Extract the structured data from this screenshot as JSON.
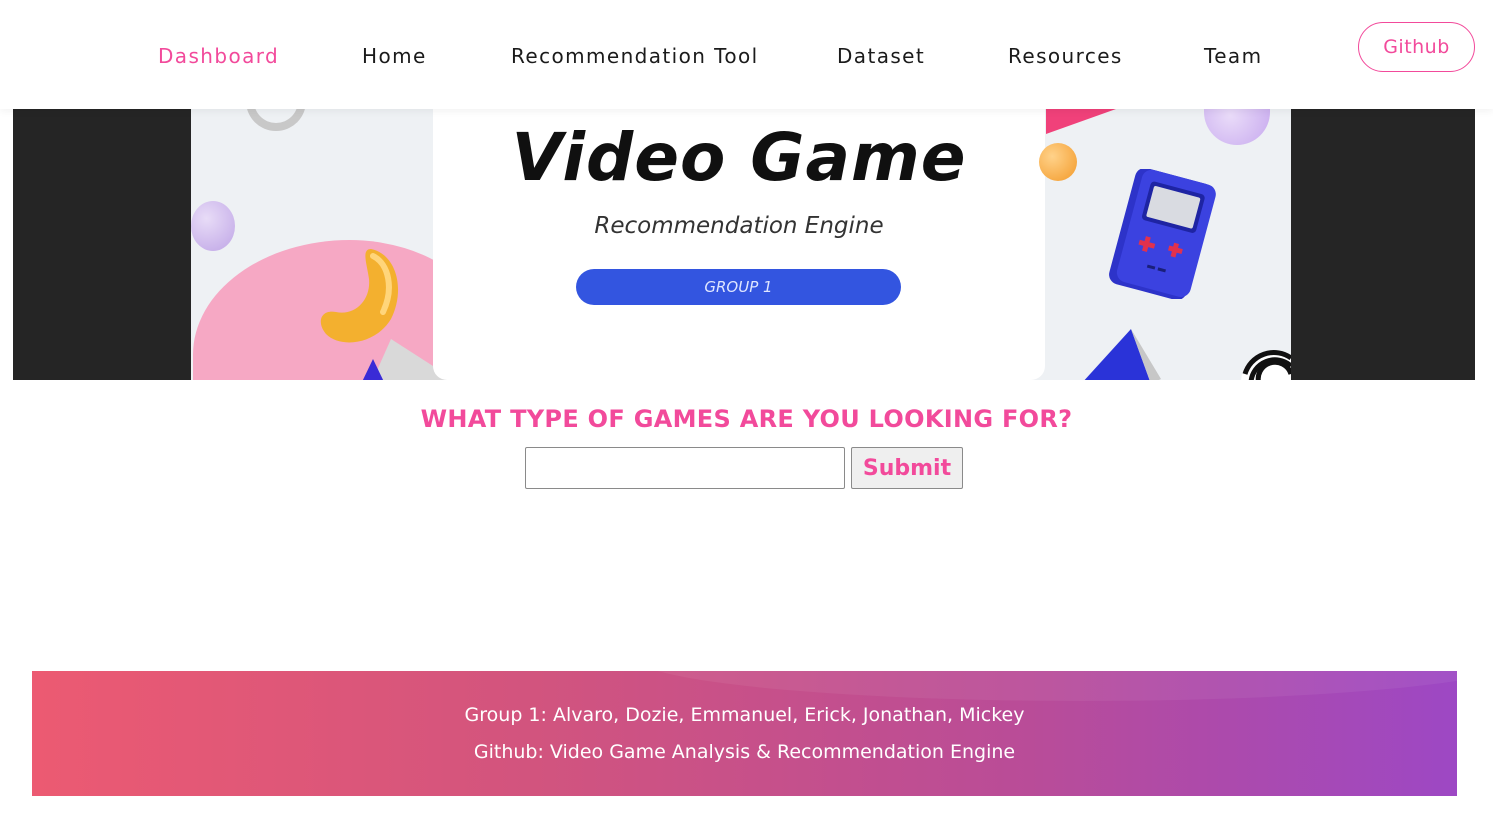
{
  "nav": {
    "items": [
      {
        "label": "Dashboard",
        "active": true
      },
      {
        "label": "Home",
        "active": false
      },
      {
        "label": "Recommendation Tool",
        "active": false
      },
      {
        "label": "Dataset",
        "active": false
      },
      {
        "label": "Resources",
        "active": false
      },
      {
        "label": "Team",
        "active": false
      }
    ],
    "github_label": "Github"
  },
  "banner": {
    "title": "Video Game",
    "subtitle": "Recommendation Engine",
    "pill": "GROUP 1"
  },
  "search": {
    "question": "WHAT TYPE OF GAMES ARE YOU LOOKING FOR?",
    "value": "",
    "submit_label": "Submit"
  },
  "footer": {
    "line1": "Group 1: Alvaro, Dozie, Emmanuel, Erick, Jonathan, Mickey",
    "line2": "Github: Video Game Analysis & Recommendation Engine"
  },
  "colors": {
    "accent": "#f24a9b",
    "banner_pill": "#3355e0",
    "footer_gradient_start": "#ec5a72",
    "footer_gradient_end": "#9d48c4"
  },
  "icons": {
    "banner_decorations": [
      "gameboy-icon",
      "controller-icon",
      "orb-icon"
    ]
  }
}
